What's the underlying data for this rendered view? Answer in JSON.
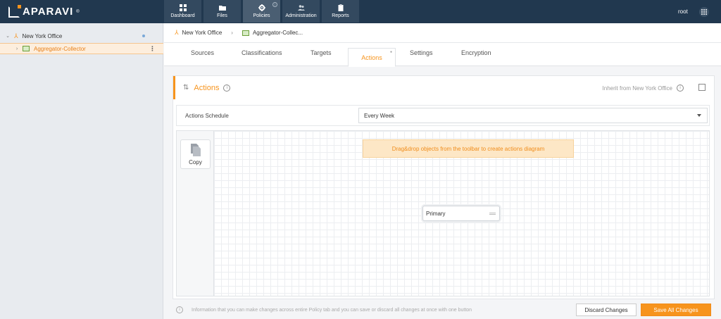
{
  "app": {
    "brand": "APARAVI",
    "brand_mark": "®",
    "user": "root",
    "accent_color": "#f7941d",
    "nav_color": "#21384f"
  },
  "nav": {
    "items": [
      {
        "label": "Dashboard",
        "icon": "dashboard-icon"
      },
      {
        "label": "Files",
        "icon": "folder-icon"
      },
      {
        "label": "Policies",
        "icon": "gear-icon",
        "active": true
      },
      {
        "label": "Administration",
        "icon": "users-icon"
      },
      {
        "label": "Reports",
        "icon": "clipboard-icon"
      }
    ]
  },
  "sidebar": {
    "tree": [
      {
        "label": "New York Office",
        "icon": "organization-icon",
        "expanded": true
      },
      {
        "label": "Aggregator-Collector",
        "icon": "collector-icon",
        "selected": true
      }
    ]
  },
  "breadcrumb": {
    "items": [
      "New York Office",
      "Aggregator-Collec..."
    ]
  },
  "tabs": {
    "items": [
      "Sources",
      "Classifications",
      "Targets",
      "Actions",
      "Settings",
      "Encryption"
    ],
    "active": "Actions"
  },
  "panel": {
    "title": "Actions",
    "inherit_label": "Inherit from New York Office",
    "schedule_label": "Actions Schedule",
    "schedule_value": "Every Week"
  },
  "diagram": {
    "toolbar_item": "Copy",
    "hint": "Drag&drop objects from the toolbar to create actions diagram",
    "node_label": "Primary"
  },
  "footer": {
    "info": "Information that you can make changes across entire Policy tab and you can save or discard all changes at once with one button",
    "discard_label": "Discard Changes",
    "save_label": "Save All Changes"
  }
}
